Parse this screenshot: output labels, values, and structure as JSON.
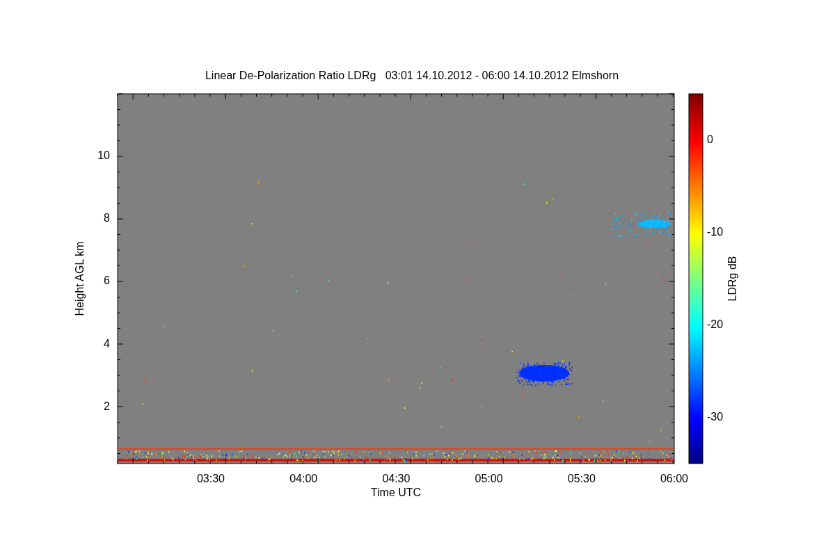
{
  "title": "Linear De-Polarization Ratio LDRg   03:01 14.10.2012 - 06:00 14.10.2012 Elmshorn",
  "x_axis": {
    "label": "Time UTC",
    "ticks": [
      "03:30",
      "04:00",
      "04:30",
      "05:00",
      "05:30",
      "06:00"
    ]
  },
  "y_axis": {
    "label": "Height AGL km",
    "ticks": [
      "10",
      "8",
      "6",
      "4",
      "2"
    ]
  },
  "colorbar": {
    "label": "LDRg dB",
    "ticks": [
      "0",
      "-10",
      "-20",
      "-30"
    ]
  }
}
